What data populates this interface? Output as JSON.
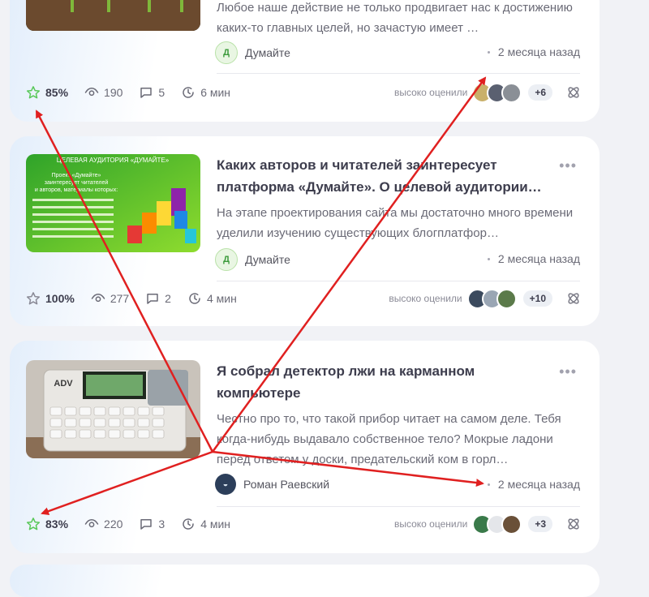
{
  "cards": [
    {
      "excerpt": "Любое наше действие не только продвигает нас к достижению каких-то главных целей, но зачастую имеет …",
      "author": "Думайте",
      "date": "2 месяца назад",
      "rating": "85%",
      "views": "190",
      "comments": "5",
      "read_time": "6 мин",
      "highly_rated_label": "высоко оценили",
      "more_count": "+6"
    },
    {
      "title": "Каких авторов и читателей заинтересует платформа «Думайте». О целевой аудитории…",
      "excerpt": "На этапе проектирования сайта мы достаточно много времени уделили изучению существующих блогплатфор…",
      "author": "Думайте",
      "date": "2 месяца назад",
      "rating": "100%",
      "views": "277",
      "comments": "2",
      "read_time": "4 мин",
      "highly_rated_label": "высоко оценили",
      "more_count": "+10",
      "thumb": {
        "header": "ЦЕЛЕВАЯ АУДИТОРИЯ «ДУМАЙТЕ»",
        "line1": "Проект «Думайте»",
        "line2": "заинтересует читателей",
        "line3": "и авторов, материалы которых:"
      }
    },
    {
      "title": "Я собрал детектор лжи на карманном компьютере",
      "excerpt": "Честно про то, что такой прибор читает на самом деле. Тебя когда-нибудь выдавало собственное тело? Мокрые ладони перед ответом у доски, предательский ком в горл…",
      "author": "Роман Раевский",
      "date": "2 месяца назад",
      "rating": "83%",
      "views": "220",
      "comments": "3",
      "read_time": "4 мин",
      "highly_rated_label": "высоко оценили",
      "more_count": "+3",
      "thumb": {
        "device_label": "ADV"
      }
    }
  ],
  "menu_glyph": "•••",
  "icons": {
    "rating": "star-icon",
    "views": "eye-icon",
    "comments": "comment-icon",
    "read_time": "clock-icon",
    "share": "share-icon",
    "menu": "more-dots-icon"
  },
  "colors": {
    "accent_green": "#5ac85a",
    "annotation_red": "#e02020"
  }
}
